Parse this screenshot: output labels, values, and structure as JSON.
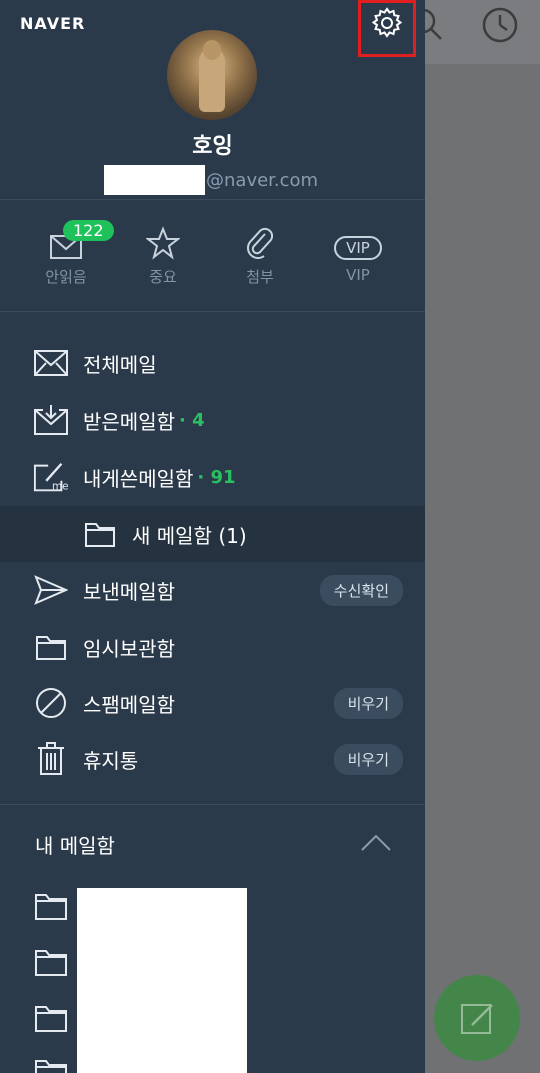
{
  "app": {
    "logo": "NAVER"
  },
  "profile": {
    "name": "호잉",
    "email_domain": "@naver.com"
  },
  "quick_actions": [
    {
      "label": "안읽음",
      "badge": "122",
      "icon": "envelope-icon"
    },
    {
      "label": "중요",
      "icon": "star-icon"
    },
    {
      "label": "첨부",
      "icon": "paperclip-icon"
    },
    {
      "label": "VIP",
      "icon": "vip-icon",
      "pill": "VIP"
    }
  ],
  "menu": [
    {
      "label": "전체메일",
      "icon": "all-mail-icon"
    },
    {
      "label": "받은메일함",
      "count": "· 4",
      "icon": "inbox-icon"
    },
    {
      "label": "내게쓴메일함",
      "count": "· 91",
      "icon": "self-mail-icon"
    },
    {
      "label": "새 메일함 (1)",
      "icon": "folder-icon",
      "sub": true
    },
    {
      "label": "보낸메일함",
      "icon": "sent-icon",
      "action": "수신확인"
    },
    {
      "label": "임시보관함",
      "icon": "folder-icon"
    },
    {
      "label": "스팸메일함",
      "icon": "spam-icon",
      "action": "비우기"
    },
    {
      "label": "휴지통",
      "icon": "trash-icon",
      "action": "비우기"
    }
  ],
  "my_mailbox": {
    "title": "내 메일함"
  },
  "colors": {
    "drawer_bg": "#2b3a4a",
    "accent_green": "#1fc25a",
    "highlight_red": "#e02020"
  }
}
